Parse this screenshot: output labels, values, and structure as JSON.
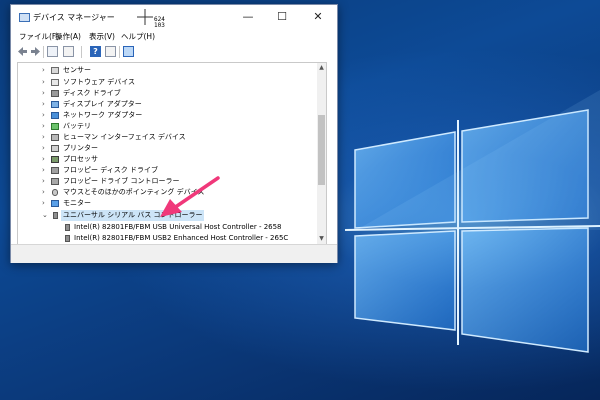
{
  "window": {
    "title": "デバイス マネージャー",
    "coordinate_readout": [
      "624",
      "103"
    ],
    "minimize_label": "—",
    "maximize_label": "☐",
    "close_label": "✕"
  },
  "menu": {
    "file": "ファイル(F)",
    "action": "操作(A)",
    "view": "表示(V)",
    "help": "ヘルプ(H)"
  },
  "toolbar": {
    "back_icon": "arrow-left-icon",
    "forward_icon": "arrow-right-icon",
    "help_label": "?"
  },
  "tree": {
    "items": [
      {
        "label": "センサー",
        "icon": "sensor-icon",
        "expanded": false
      },
      {
        "label": "ソフトウェア デバイス",
        "icon": "software-device-icon",
        "expanded": false
      },
      {
        "label": "ディスク ドライブ",
        "icon": "disk-drive-icon",
        "expanded": false
      },
      {
        "label": "ディスプレイ アダプター",
        "icon": "display-adapter-icon",
        "expanded": false
      },
      {
        "label": "ネットワーク アダプター",
        "icon": "network-adapter-icon",
        "expanded": false
      },
      {
        "label": "バッテリ",
        "icon": "battery-icon",
        "expanded": false
      },
      {
        "label": "ヒューマン インターフェイス デバイス",
        "icon": "hid-icon",
        "expanded": false
      },
      {
        "label": "プリンター",
        "icon": "printer-icon",
        "expanded": false
      },
      {
        "label": "プロセッサ",
        "icon": "processor-icon",
        "expanded": false
      },
      {
        "label": "フロッピー ディスク ドライブ",
        "icon": "floppy-drive-icon",
        "expanded": false
      },
      {
        "label": "フロッピー ドライブ コントローラー",
        "icon": "floppy-controller-icon",
        "expanded": false
      },
      {
        "label": "マウスとそのほかのポインティング デバイス",
        "icon": "mouse-icon",
        "expanded": false
      },
      {
        "label": "モニター",
        "icon": "monitor-icon",
        "expanded": false
      },
      {
        "label": "ユニバーサル シリアル バス コントローラー",
        "icon": "usb-icon",
        "expanded": true,
        "selected": true
      }
    ],
    "children": [
      {
        "label": "Intel(R) 82801FB/FBM USB Universal Host Controller - 2658",
        "icon": "usb-plug-icon"
      },
      {
        "label": "Intel(R) 82801FB/FBM USB2 Enhanced Host Controller - 265C",
        "icon": "usb-plug-icon"
      }
    ]
  },
  "colors": {
    "annotation_arrow": "#f0387a",
    "selection": "#cce4f7",
    "desktop": "#0d4a96"
  }
}
